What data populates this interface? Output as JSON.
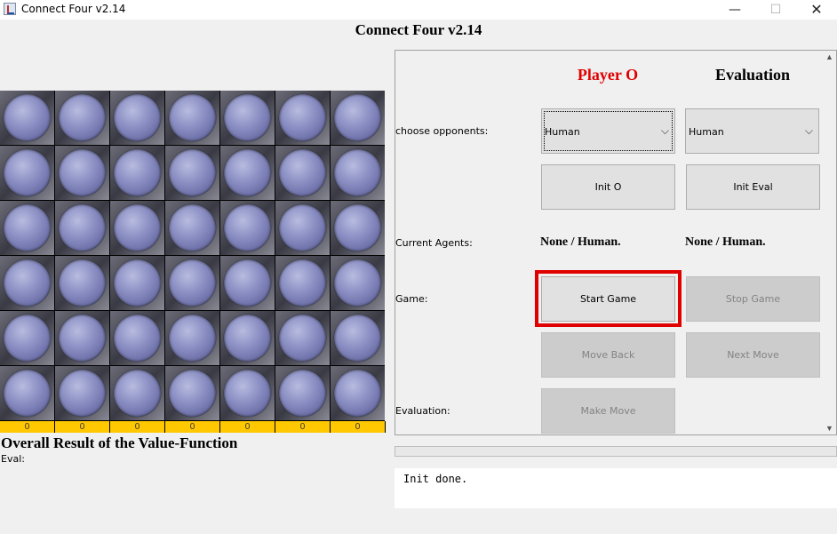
{
  "window": {
    "title": "Connect Four v2.14",
    "controls": {
      "minimize": "—",
      "maximize": "☐",
      "close": "✕"
    }
  },
  "main_title": "Connect Four v2.14",
  "board": {
    "rows": 6,
    "cols": 7,
    "column_counts": [
      "0",
      "0",
      "0",
      "0",
      "0",
      "0",
      "0"
    ],
    "count_bar_color": "#ffc800"
  },
  "result": {
    "title": "Overall Result of the Value-Function",
    "eval_label": "Eval:"
  },
  "control_panel": {
    "player_o_header": "Player O",
    "player_o_color": "#e00000",
    "evaluation_header": "Evaluation",
    "choose_opponents_label": "choose opponents:",
    "opponent_o_value": "Human",
    "opponent_eval_value": "Human",
    "init_o_label": "Init O",
    "init_eval_label": "Init Eval",
    "current_agents_label": "Current Agents:",
    "agent_o": "None / Human.",
    "agent_eval": "None / Human.",
    "game_label": "Game:",
    "start_game_label": "Start Game",
    "stop_game_label": "Stop Game",
    "move_back_label": "Move Back",
    "next_move_label": "Next Move",
    "evaluation_label": "Evaluation:",
    "make_move_label": "Make Move"
  },
  "log": {
    "text": "Init done."
  }
}
